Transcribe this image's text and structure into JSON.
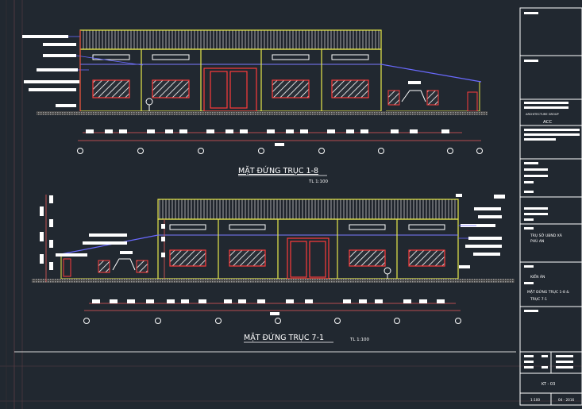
{
  "drawing": {
    "elevation_top": {
      "title": "MẶT ĐỨNG TRỤC 1-8",
      "scale": "TL 1:100"
    },
    "elevation_bottom": {
      "title": "MẶT ĐỨNG TRỤC 7-1",
      "scale": "TL 1:100"
    }
  },
  "title_block": {
    "company_line": "ARCHITECTURE GROUP",
    "company_abbr": "ACC",
    "project_name_1": "TRỤ SỞ UBND XÃ",
    "project_name_2": "PHÚ AN",
    "stage": "KIẾN ÁN",
    "sheet_title_1": "MẶT ĐỨNG TRỤC 1-8 &",
    "sheet_title_2": "TRỤC 7-1",
    "sheet_no": "KT - 03",
    "scale": "1:100",
    "date": "04 - 2016"
  },
  "colors": {
    "background": "#212830",
    "wall_outline": "#e8e84a",
    "window_red": "#ff3b3b",
    "dimension": "#e85a5a",
    "text_white": "#ffffff",
    "roof_line": "#6a6aff",
    "ground": "#9a9a9a",
    "frame": "#c94a4a"
  }
}
